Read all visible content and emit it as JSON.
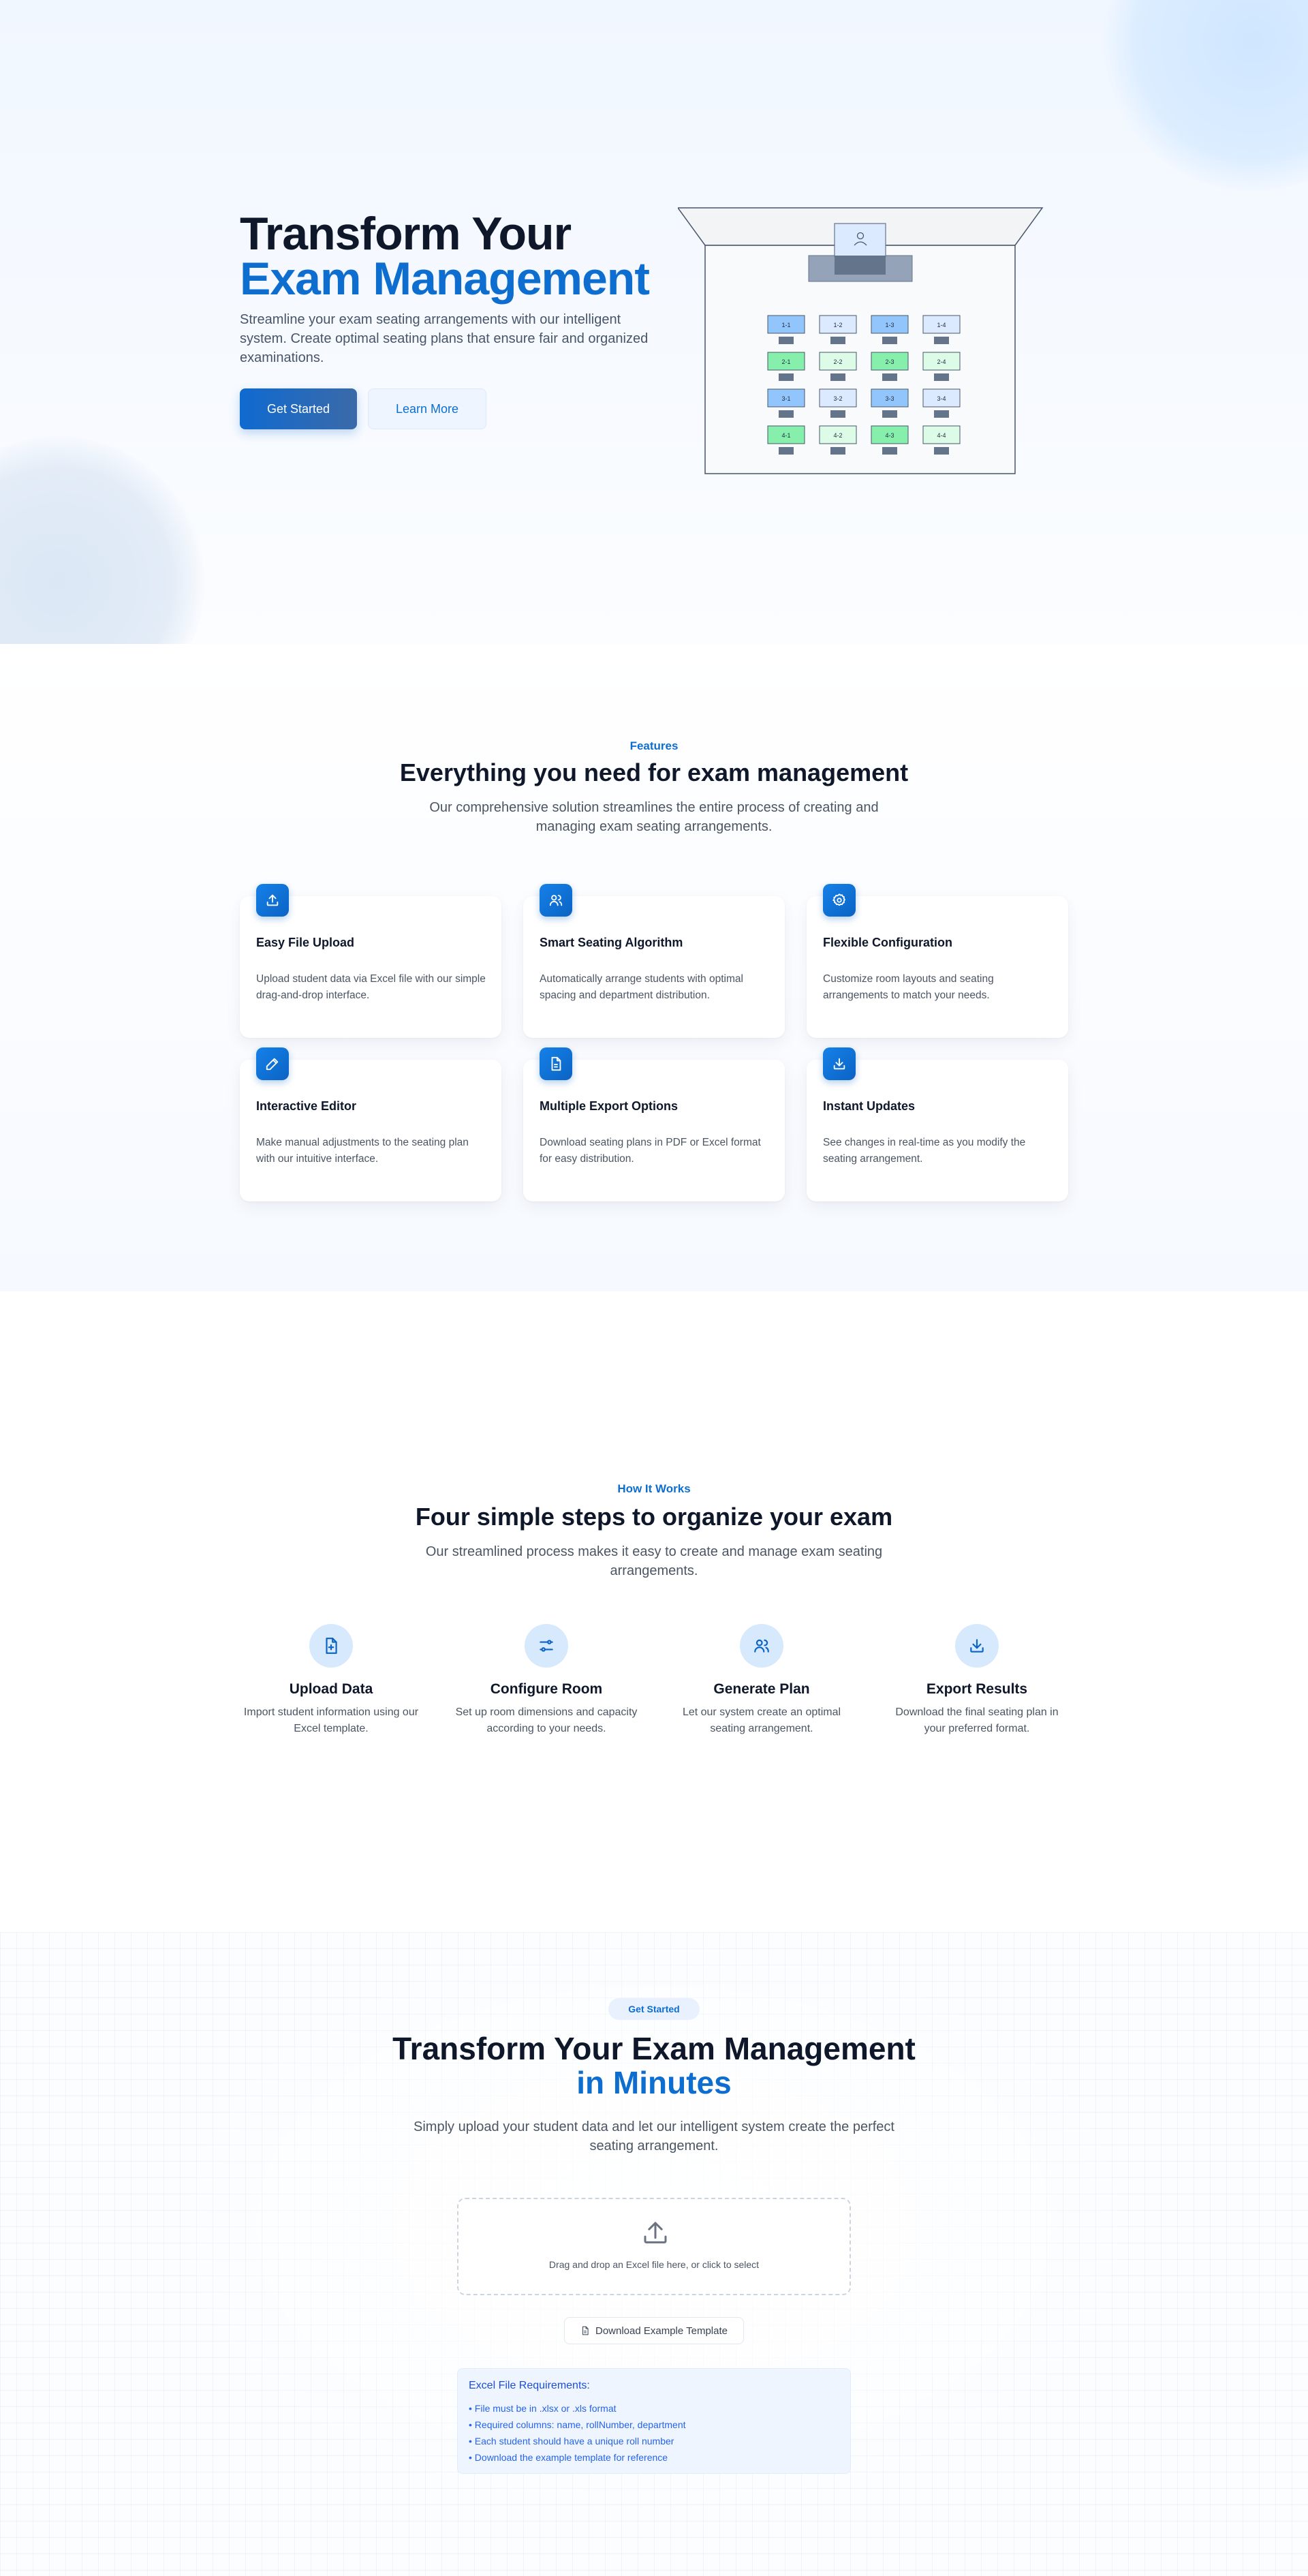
{
  "hero": {
    "title_line1": "Transform Your",
    "title_line2": "Exam Management",
    "subtitle": "Streamline your exam seating arrangements with our intelligent system. Create optimal seating plans that ensure fair and organized examinations.",
    "primary_button": "Get Started",
    "secondary_button": "Learn More",
    "classroom": {
      "rows": [
        [
          {
            "label": "1-1",
            "status": "blue"
          },
          {
            "label": "1-2",
            "status": "light"
          },
          {
            "label": "1-3",
            "status": "blue"
          },
          {
            "label": "1-4",
            "status": "light"
          }
        ],
        [
          {
            "label": "2-1",
            "status": "green"
          },
          {
            "label": "2-2",
            "status": "lightgreen"
          },
          {
            "label": "2-3",
            "status": "green"
          },
          {
            "label": "2-4",
            "status": "lightgreen"
          }
        ],
        [
          {
            "label": "3-1",
            "status": "blue"
          },
          {
            "label": "3-2",
            "status": "light"
          },
          {
            "label": "3-3",
            "status": "blue"
          },
          {
            "label": "3-4",
            "status": "light"
          }
        ],
        [
          {
            "label": "4-1",
            "status": "green"
          },
          {
            "label": "4-2",
            "status": "lightgreen"
          },
          {
            "label": "4-3",
            "status": "green"
          },
          {
            "label": "4-4",
            "status": "lightgreen"
          }
        ]
      ]
    }
  },
  "features": {
    "eyebrow": "Features",
    "title": "Everything you need for exam management",
    "subtitle": "Our comprehensive solution streamlines the entire process of creating and managing exam seating arrangements.",
    "items": [
      {
        "title": "Easy File Upload",
        "desc": "Upload student data via Excel file with our simple drag-and-drop interface.",
        "icon": "upload-icon"
      },
      {
        "title": "Smart Seating Algorithm",
        "desc": "Automatically arrange students with optimal spacing and department distribution.",
        "icon": "users-icon"
      },
      {
        "title": "Flexible Configuration",
        "desc": "Customize room layouts and seating arrangements to match your needs.",
        "icon": "gear-icon"
      },
      {
        "title": "Interactive Editor",
        "desc": "Make manual adjustments to the seating plan with our intuitive interface.",
        "icon": "pencil-icon"
      },
      {
        "title": "Multiple Export Options",
        "desc": "Download seating plans in PDF or Excel format for easy distribution.",
        "icon": "document-icon"
      },
      {
        "title": "Instant Updates",
        "desc": "See changes in real-time as you modify the seating arrangement.",
        "icon": "download-icon"
      }
    ]
  },
  "how_it_works": {
    "eyebrow": "How It Works",
    "title": "Four simple steps to organize your exam",
    "subtitle": "Our streamlined process makes it easy to create and manage exam seating arrangements.",
    "steps": [
      {
        "title": "Upload Data",
        "desc": "Import student information using our Excel template.",
        "icon": "file-plus-icon"
      },
      {
        "title": "Configure Room",
        "desc": "Set up room dimensions and capacity according to your needs.",
        "icon": "sliders-icon"
      },
      {
        "title": "Generate Plan",
        "desc": "Let our system create an optimal seating arrangement.",
        "icon": "users-icon"
      },
      {
        "title": "Export Results",
        "desc": "Download the final seating plan in your preferred format.",
        "icon": "download-icon"
      }
    ]
  },
  "get_started": {
    "pill": "Get Started",
    "title_line1": "Transform Your Exam Management",
    "title_line2": "in Minutes",
    "subtitle": "Simply upload your student data and let our intelligent system create the perfect seating arrangement.",
    "dropzone_text": "Drag and drop an Excel file here, or click to select",
    "template_button": "Download Example Template",
    "requirements_title": "Excel File Requirements:",
    "requirements": [
      "• File must be in .xlsx or .xls format",
      "• Required columns: name, rollNumber, department",
      "• Each student should have a unique roll number",
      "• Download the example template for reference"
    ]
  },
  "colors": {
    "accent": "#0d6ecf",
    "seat_blue": "#93c5fd",
    "seat_light": "#dbeafe",
    "seat_green": "#86efac",
    "seat_lightgreen": "#dcfce7"
  }
}
